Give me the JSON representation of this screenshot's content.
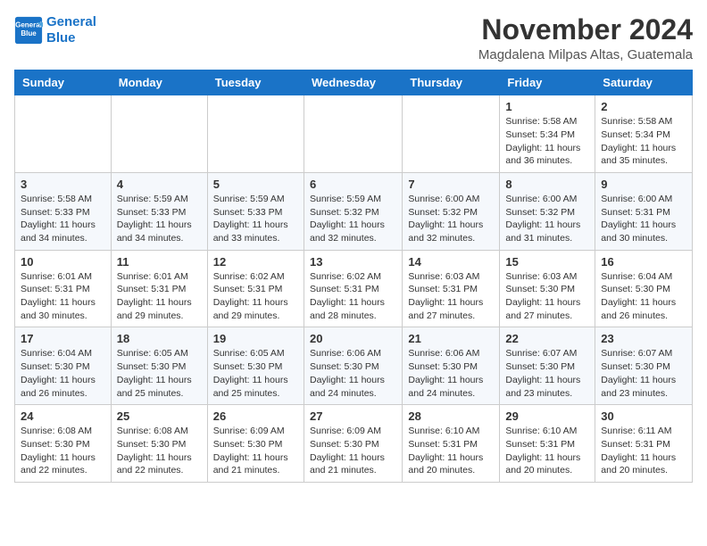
{
  "header": {
    "logo_line1": "General",
    "logo_line2": "Blue",
    "month": "November 2024",
    "location": "Magdalena Milpas Altas, Guatemala"
  },
  "weekdays": [
    "Sunday",
    "Monday",
    "Tuesday",
    "Wednesday",
    "Thursday",
    "Friday",
    "Saturday"
  ],
  "weeks": [
    [
      {
        "day": "",
        "info": ""
      },
      {
        "day": "",
        "info": ""
      },
      {
        "day": "",
        "info": ""
      },
      {
        "day": "",
        "info": ""
      },
      {
        "day": "",
        "info": ""
      },
      {
        "day": "1",
        "info": "Sunrise: 5:58 AM\nSunset: 5:34 PM\nDaylight: 11 hours and 36 minutes."
      },
      {
        "day": "2",
        "info": "Sunrise: 5:58 AM\nSunset: 5:34 PM\nDaylight: 11 hours and 35 minutes."
      }
    ],
    [
      {
        "day": "3",
        "info": "Sunrise: 5:58 AM\nSunset: 5:33 PM\nDaylight: 11 hours and 34 minutes."
      },
      {
        "day": "4",
        "info": "Sunrise: 5:59 AM\nSunset: 5:33 PM\nDaylight: 11 hours and 34 minutes."
      },
      {
        "day": "5",
        "info": "Sunrise: 5:59 AM\nSunset: 5:33 PM\nDaylight: 11 hours and 33 minutes."
      },
      {
        "day": "6",
        "info": "Sunrise: 5:59 AM\nSunset: 5:32 PM\nDaylight: 11 hours and 32 minutes."
      },
      {
        "day": "7",
        "info": "Sunrise: 6:00 AM\nSunset: 5:32 PM\nDaylight: 11 hours and 32 minutes."
      },
      {
        "day": "8",
        "info": "Sunrise: 6:00 AM\nSunset: 5:32 PM\nDaylight: 11 hours and 31 minutes."
      },
      {
        "day": "9",
        "info": "Sunrise: 6:00 AM\nSunset: 5:31 PM\nDaylight: 11 hours and 30 minutes."
      }
    ],
    [
      {
        "day": "10",
        "info": "Sunrise: 6:01 AM\nSunset: 5:31 PM\nDaylight: 11 hours and 30 minutes."
      },
      {
        "day": "11",
        "info": "Sunrise: 6:01 AM\nSunset: 5:31 PM\nDaylight: 11 hours and 29 minutes."
      },
      {
        "day": "12",
        "info": "Sunrise: 6:02 AM\nSunset: 5:31 PM\nDaylight: 11 hours and 29 minutes."
      },
      {
        "day": "13",
        "info": "Sunrise: 6:02 AM\nSunset: 5:31 PM\nDaylight: 11 hours and 28 minutes."
      },
      {
        "day": "14",
        "info": "Sunrise: 6:03 AM\nSunset: 5:31 PM\nDaylight: 11 hours and 27 minutes."
      },
      {
        "day": "15",
        "info": "Sunrise: 6:03 AM\nSunset: 5:30 PM\nDaylight: 11 hours and 27 minutes."
      },
      {
        "day": "16",
        "info": "Sunrise: 6:04 AM\nSunset: 5:30 PM\nDaylight: 11 hours and 26 minutes."
      }
    ],
    [
      {
        "day": "17",
        "info": "Sunrise: 6:04 AM\nSunset: 5:30 PM\nDaylight: 11 hours and 26 minutes."
      },
      {
        "day": "18",
        "info": "Sunrise: 6:05 AM\nSunset: 5:30 PM\nDaylight: 11 hours and 25 minutes."
      },
      {
        "day": "19",
        "info": "Sunrise: 6:05 AM\nSunset: 5:30 PM\nDaylight: 11 hours and 25 minutes."
      },
      {
        "day": "20",
        "info": "Sunrise: 6:06 AM\nSunset: 5:30 PM\nDaylight: 11 hours and 24 minutes."
      },
      {
        "day": "21",
        "info": "Sunrise: 6:06 AM\nSunset: 5:30 PM\nDaylight: 11 hours and 24 minutes."
      },
      {
        "day": "22",
        "info": "Sunrise: 6:07 AM\nSunset: 5:30 PM\nDaylight: 11 hours and 23 minutes."
      },
      {
        "day": "23",
        "info": "Sunrise: 6:07 AM\nSunset: 5:30 PM\nDaylight: 11 hours and 23 minutes."
      }
    ],
    [
      {
        "day": "24",
        "info": "Sunrise: 6:08 AM\nSunset: 5:30 PM\nDaylight: 11 hours and 22 minutes."
      },
      {
        "day": "25",
        "info": "Sunrise: 6:08 AM\nSunset: 5:30 PM\nDaylight: 11 hours and 22 minutes."
      },
      {
        "day": "26",
        "info": "Sunrise: 6:09 AM\nSunset: 5:30 PM\nDaylight: 11 hours and 21 minutes."
      },
      {
        "day": "27",
        "info": "Sunrise: 6:09 AM\nSunset: 5:30 PM\nDaylight: 11 hours and 21 minutes."
      },
      {
        "day": "28",
        "info": "Sunrise: 6:10 AM\nSunset: 5:31 PM\nDaylight: 11 hours and 20 minutes."
      },
      {
        "day": "29",
        "info": "Sunrise: 6:10 AM\nSunset: 5:31 PM\nDaylight: 11 hours and 20 minutes."
      },
      {
        "day": "30",
        "info": "Sunrise: 6:11 AM\nSunset: 5:31 PM\nDaylight: 11 hours and 20 minutes."
      }
    ]
  ]
}
